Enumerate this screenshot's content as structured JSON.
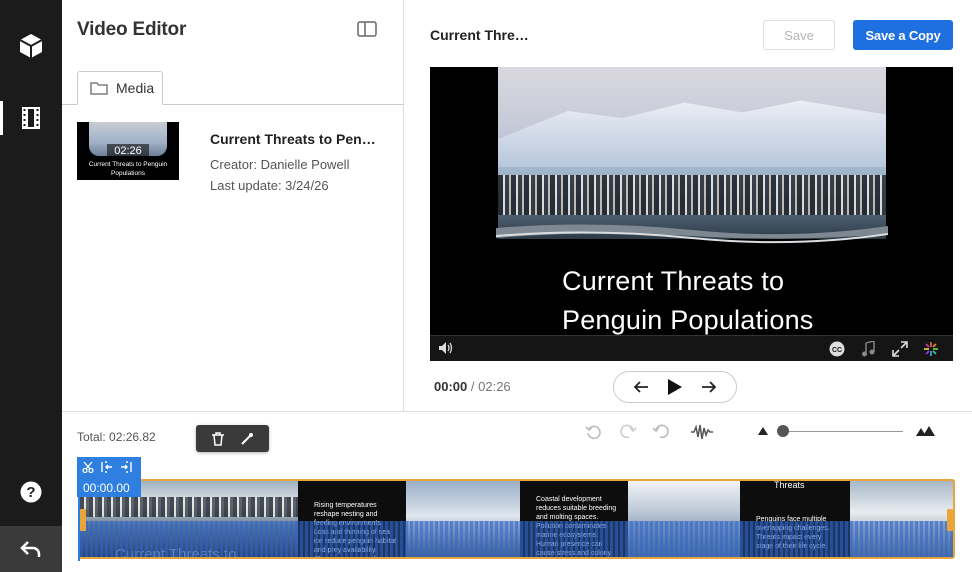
{
  "rail": {
    "items": [
      {
        "name": "media-library",
        "icon": "cube-icon"
      },
      {
        "name": "video-editor",
        "icon": "film-strip-icon",
        "active": true
      }
    ],
    "help_icon": "help-circle-icon",
    "back_icon": "undo-arrow-icon"
  },
  "panel": {
    "title": "Video Editor",
    "tab_label": "Media",
    "item": {
      "thumb_duration": "02:26",
      "thumb_caption": "Current Threats to Penguin Populations",
      "title": "Current Threats to Pen…",
      "creator": "Creator: Danielle Powell",
      "updated": "Last update: 3/24/26"
    }
  },
  "player": {
    "title": "Current Thre…",
    "save_label": "Save",
    "save_copy_label": "Save a Copy",
    "caption_line1": "Current Threats to",
    "caption_line2": "Penguin Populations",
    "current_time": "00:00",
    "separator": "/",
    "total_time": "02:26"
  },
  "timeline": {
    "total": "Total: 02:26.82",
    "playhead_time": "00:00.00",
    "accent": "#e8a53a",
    "primary": "#1e6fe0",
    "slides": [
      {
        "text": "Rising temperatures reshape nesting and feeding environments. Loss and thinning of sea ice reduce penguin habitat and prey availability. Changing currents force"
      },
      {
        "text": "Coastal development reduces suitable breeding and molting spaces. Pollution contaminates marine ecosystems. Human presence can cause stress and colony"
      },
      {
        "heading": "Threats",
        "text": "Penguins face multiple overlapping challenges. Threats impact every stage of their life cycle."
      }
    ],
    "first_frame_caption": "Current Threats to"
  }
}
